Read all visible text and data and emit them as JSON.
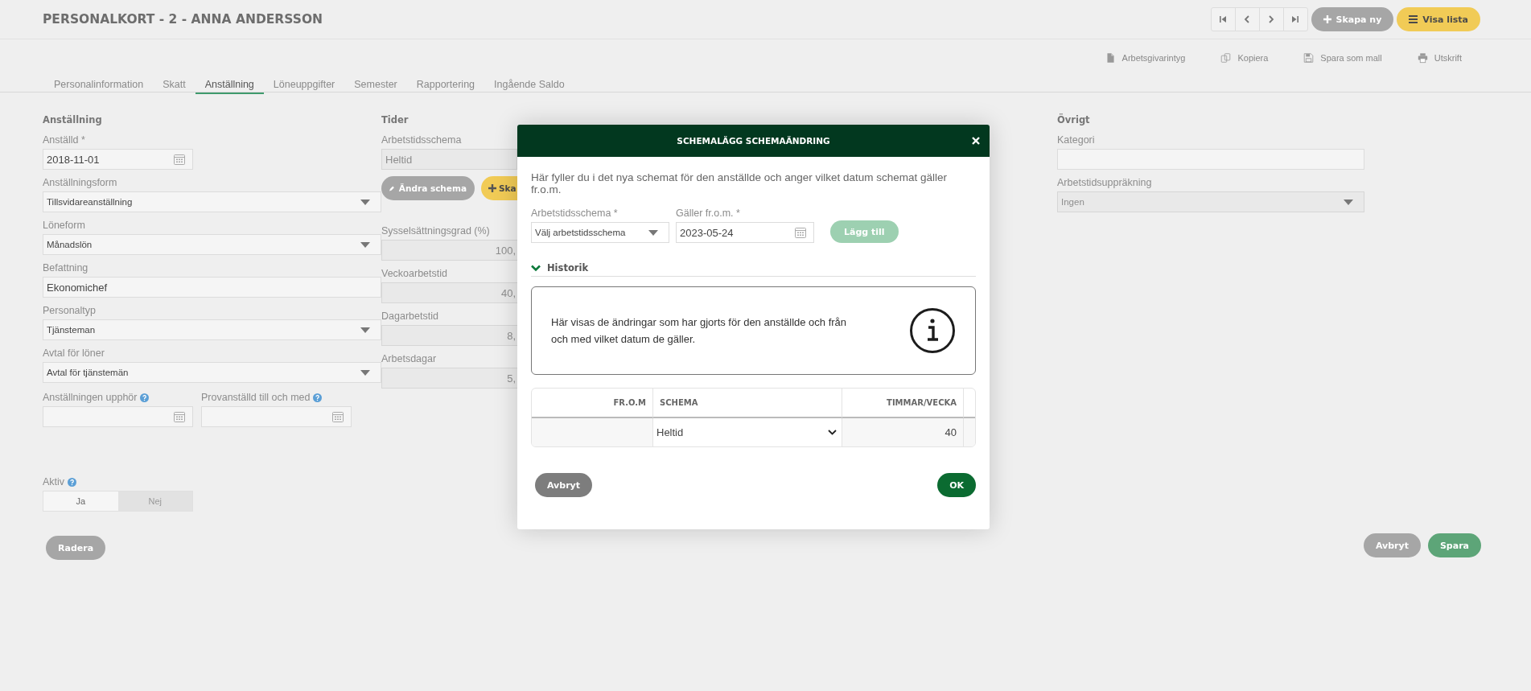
{
  "header": {
    "title": "PERSONALKORT - 2 - ANNA ANDERSSON",
    "buttons": [
      {
        "label": "Skapa ny",
        "kind": "secondary"
      },
      {
        "label": "Visa lista",
        "kind": "primary"
      }
    ]
  },
  "actions": [
    {
      "label": "Arbetsgivarintyg"
    },
    {
      "label": "Kopiera"
    },
    {
      "label": "Spara som mall"
    },
    {
      "label": "Utskrift"
    }
  ],
  "tabs": [
    {
      "label": "Personalinformation",
      "selected": false
    },
    {
      "label": "Skatt",
      "selected": false
    },
    {
      "label": "Anställning",
      "selected": true
    },
    {
      "label": "Löneuppgifter",
      "selected": false
    },
    {
      "label": "Semester",
      "selected": false
    },
    {
      "label": "Rapportering",
      "selected": false
    },
    {
      "label": "Ingående Saldo",
      "selected": false
    }
  ],
  "employment": {
    "heading": "Anställning",
    "fields": [
      {
        "label": "Anställd *",
        "kind": "date",
        "value": "2018-11-01",
        "disabled": false,
        "help": false
      },
      {
        "label": "Anställningsform",
        "kind": "select",
        "value": "Tillsvidareanställning",
        "disabled": false,
        "help": false
      },
      {
        "label": "Löneform",
        "kind": "select",
        "value": "Månadslön",
        "disabled": false,
        "help": false
      },
      {
        "label": "Befattning",
        "kind": "text",
        "value": "Ekonomichef",
        "disabled": false,
        "help": false
      },
      {
        "label": "Personaltyp",
        "kind": "select",
        "value": "Tjänsteman",
        "disabled": false,
        "help": false
      },
      {
        "label": "Avtal för löner",
        "kind": "select",
        "value": "Avtal för tjänstemän",
        "disabled": false,
        "help": false
      }
    ],
    "date_pair": [
      {
        "label": "Anställningen upphör",
        "kind": "date",
        "disabled": false,
        "help": true
      },
      {
        "label": "Provanställd till och med",
        "kind": "date",
        "disabled": false,
        "help": true
      }
    ],
    "active": {
      "label": "Aktiv",
      "help": true,
      "options": [
        {
          "label": "Ja",
          "selected": true
        },
        {
          "label": "Nej",
          "selected": false
        }
      ]
    },
    "delete_button": "Radera"
  },
  "times": {
    "heading": "Tider",
    "schedule": {
      "label": "Arbetstidsschema",
      "kind": "text",
      "value": "Heltid",
      "disabled": true,
      "help": false
    },
    "buttons": [
      {
        "label": "Ändra schema",
        "kind": "secondary"
      },
      {
        "label": "Ska",
        "kind": "primary"
      }
    ],
    "fields": [
      {
        "label": "Sysselsättningsgrad (%)",
        "kind": "number",
        "value": "100,",
        "disabled": true,
        "help": false
      },
      {
        "label": "Veckoarbetstid",
        "kind": "number",
        "value": "40,",
        "disabled": true,
        "help": false
      },
      {
        "label": "Dagarbetstid",
        "kind": "number",
        "value": "8,",
        "disabled": true,
        "help": false
      },
      {
        "label": "Arbetsdagar",
        "kind": "number",
        "value": "5,",
        "disabled": true,
        "help": false
      }
    ]
  },
  "other": {
    "heading": "Övrigt",
    "fields": [
      {
        "label": "Kategori",
        "kind": "text",
        "disabled": false,
        "help": false
      },
      {
        "label": "Arbetstidsuppräkning",
        "kind": "select",
        "value": "Ingen",
        "disabled": true,
        "help": false
      }
    ]
  },
  "footer_buttons": [
    {
      "label": "Avbryt",
      "kind": "secondary"
    },
    {
      "label": "Spara",
      "kind": "primary"
    }
  ],
  "dialog": {
    "title": "SCHEMALÄGG SCHEMAÄNDRING",
    "intro": "Här fyller du i det nya schemat för den anställde och anger vilket datum schemat gäller fr.o.m.",
    "fields": [
      {
        "label": "Arbetstidsschema *",
        "kind": "select",
        "value": "Välj arbetstidsschema",
        "disabled": false,
        "help": false
      },
      {
        "label": "Gäller fr.o.m. *",
        "kind": "date",
        "value": "2023-05-24",
        "disabled": false,
        "help": false
      }
    ],
    "add_button": {
      "label": "Lägg till",
      "disabled": true
    },
    "history": {
      "label": "Historik",
      "expanded": true
    },
    "info": "Här visas de ändringar som har gjorts för den anställde och från och med vilket datum de gäller.",
    "table": {
      "columns": [
        "FR.O.M",
        "SCHEMA",
        "TIMMAR/VECKA"
      ],
      "rows": [
        {
          "schema": "Heltid",
          "hours": "40"
        }
      ]
    },
    "buttons": [
      {
        "label": "Avbryt",
        "kind": "secondary"
      },
      {
        "label": "OK",
        "kind": "primary"
      }
    ]
  }
}
